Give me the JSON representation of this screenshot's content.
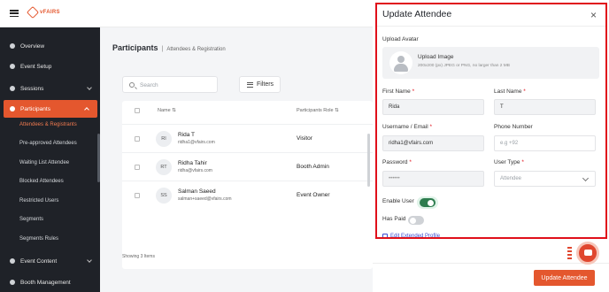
{
  "brand": {
    "logo_text": "vFAIRS",
    "accent": "#e4572e"
  },
  "sidebar": {
    "items": [
      {
        "label": "Overview",
        "icon": "globe-icon"
      },
      {
        "label": "Event Setup",
        "icon": "star-icon"
      },
      {
        "label": "Sessions",
        "icon": "grid-icon"
      },
      {
        "label": "Participants",
        "icon": "users-icon"
      },
      {
        "label": "Event Content",
        "icon": "folder-icon"
      },
      {
        "label": "Booth Management",
        "icon": "booth-icon"
      }
    ],
    "sub_items": [
      "Attendees & Registrants",
      "Pre-approved Attendees",
      "Waiting List Attendee",
      "Blocked Attendees",
      "Restricted Users",
      "Segments",
      "Segments Rules"
    ]
  },
  "main": {
    "title": "Participants",
    "subtitle": "Attendees & Registration",
    "search_placeholder": "Search",
    "filters_label": "Filters",
    "col_name": "Name ⇅",
    "col_role": "Participants Role ⇅",
    "rows": [
      {
        "initials": "RI",
        "name": "Rida T",
        "email": "ridha1@vfairs.com",
        "role": "Visitor"
      },
      {
        "initials": "RT",
        "name": "Ridha Tahir",
        "email": "ridha@vfairs.com",
        "role": "Booth Admin"
      },
      {
        "initials": "SS",
        "name": "Salman Saeed",
        "email": "salman+saeed@vfairs.com",
        "role": "Event Owner"
      }
    ],
    "showing": "Showing 3 Items"
  },
  "modal": {
    "title": "Update Attendee",
    "close": "×",
    "upload_label": "Upload Avatar",
    "upload_title": "Upload Image",
    "upload_hint": "200x200 (px) JPEG or PNG, no larger than 2 MB",
    "first_name_label": "First Name",
    "first_name_value": "Rida",
    "last_name_label": "Last Name",
    "last_name_value": "T",
    "username_label": "Username / Email",
    "username_value": "ridha1@vfairs.com",
    "phone_label": "Phone Number",
    "phone_placeholder": "e.g +92",
    "password_label": "Password",
    "password_value": "••••••",
    "user_type_label": "User Type",
    "user_type_value": "Attendee",
    "required_mark": "*",
    "enable_user_label": "Enable User",
    "enable_user_on": true,
    "has_paid_label": "Has Paid",
    "has_paid_on": false,
    "edit_profile_link": "Edit Extended Profile",
    "update_button": "Update Attendee",
    "highlight_color": "#e0101a"
  }
}
